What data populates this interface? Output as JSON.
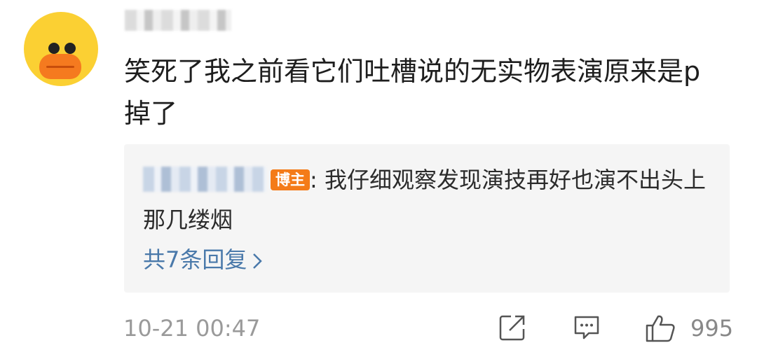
{
  "comment": {
    "text": "笑死了我之前看它们吐槽说的无实物表演原来是p掉了",
    "timestamp": "10-21 00:47",
    "like_count": "995"
  },
  "reply": {
    "badge": "博主",
    "text": ": 我仔细观察发现演技再好也演不出头上那几缕烟",
    "more_replies": "共7条回复"
  },
  "icons": {
    "avatar": "duck-avatar",
    "repost": "share-icon",
    "comment": "comment-icon",
    "like": "thumbs-up-icon",
    "chevron": "chevron-right-icon"
  },
  "colors": {
    "link": "#4a79aa",
    "badge": "#f47b18",
    "reply_bg": "#f5f5f5",
    "muted": "#9a9a9a"
  }
}
